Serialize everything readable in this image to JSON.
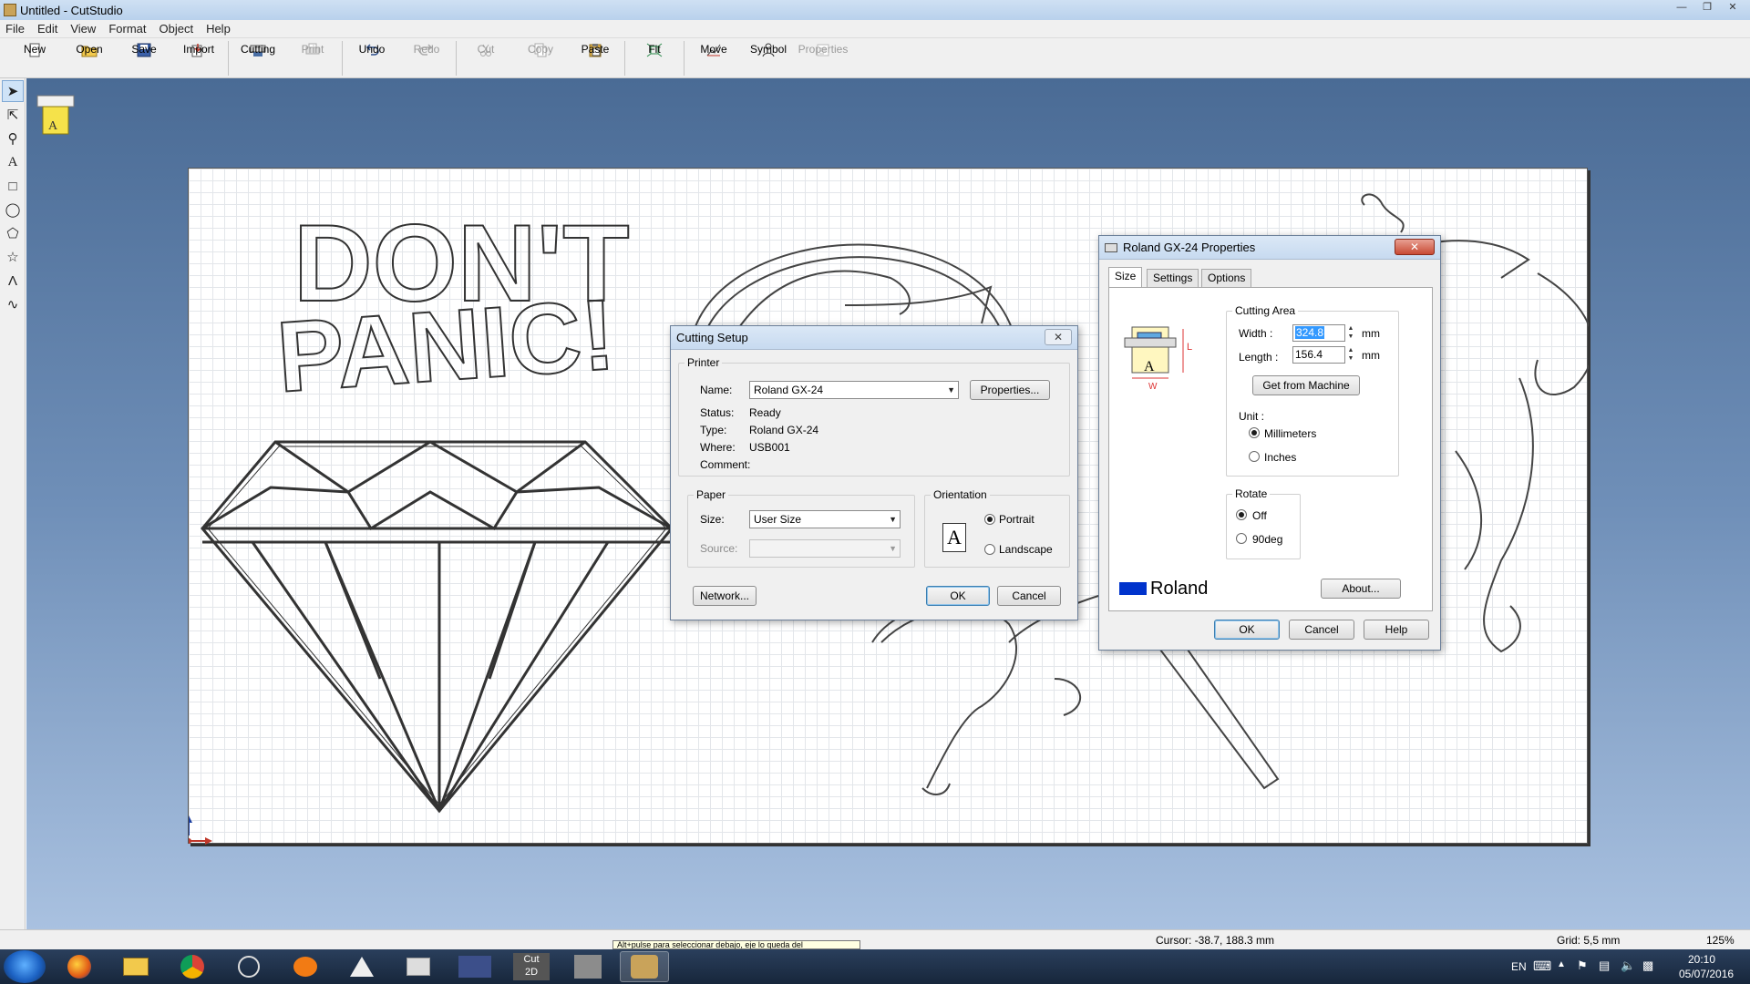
{
  "window": {
    "title": "Untitled - CutStudio"
  },
  "menu": [
    "File",
    "Edit",
    "View",
    "Format",
    "Object",
    "Help"
  ],
  "toolbar": {
    "new": "New",
    "open": "Open",
    "save": "Save",
    "import": "Import",
    "cutting": "Cutting",
    "print": "Print",
    "undo": "Undo",
    "redo": "Redo",
    "cut": "Cut",
    "copy": "Copy",
    "paste": "Paste",
    "fit": "Fit",
    "move": "Move",
    "symbol": "Symbol",
    "properties": "Properties"
  },
  "canvas": {
    "text_line1": "DON'T",
    "text_line2": "PANIC!"
  },
  "cutting_setup": {
    "title": "Cutting Setup",
    "printer_group": "Printer",
    "name_label": "Name:",
    "name_value": "Roland GX-24",
    "properties_btn": "Properties...",
    "status_label": "Status:",
    "status_value": "Ready",
    "type_label": "Type:",
    "type_value": "Roland GX-24",
    "where_label": "Where:",
    "where_value": "USB001",
    "comment_label": "Comment:",
    "paper_group": "Paper",
    "size_label": "Size:",
    "size_value": "User Size",
    "source_label": "Source:",
    "orientation_group": "Orientation",
    "orientation_glyph": "A",
    "portrait": "Portrait",
    "landscape": "Landscape",
    "network_btn": "Network...",
    "ok_btn": "OK",
    "cancel_btn": "Cancel"
  },
  "gx_properties": {
    "title": "Roland GX-24 Properties",
    "tabs": [
      "Size",
      "Settings",
      "Options"
    ],
    "cutting_area_group": "Cutting Area",
    "width_label": "Width :",
    "width_value": "324.8",
    "length_label": "Length :",
    "length_value": "156.4",
    "unit_mm": "mm",
    "get_from_machine": "Get from Machine",
    "unit_label": "Unit :",
    "millimeters": "Millimeters",
    "inches": "Inches",
    "rotate_group": "Rotate",
    "off": "Off",
    "deg90": "90deg",
    "brand": "Roland",
    "about_btn": "About...",
    "ok_btn": "OK",
    "cancel_btn": "Cancel",
    "help_btn": "Help",
    "diagram_l": "L",
    "diagram_w": "W",
    "diagram_a": "A"
  },
  "statusbar": {
    "cursor": "Cursor: -38.7, 188.3 mm",
    "grid": "Grid: 5,5 mm",
    "zoom": "125%",
    "hint": "Alt+pulse para seleccionar debajo, eje lo queda del"
  },
  "taskbar": {
    "language": "EN",
    "time": "20:10",
    "date": "05/07/2016",
    "cut2d_label": "Cut",
    "cut2d_sub": "2D"
  },
  "colors": {
    "accent": "#3399ff",
    "brand_blue": "#0033cc",
    "red_close": "#c84a34"
  }
}
